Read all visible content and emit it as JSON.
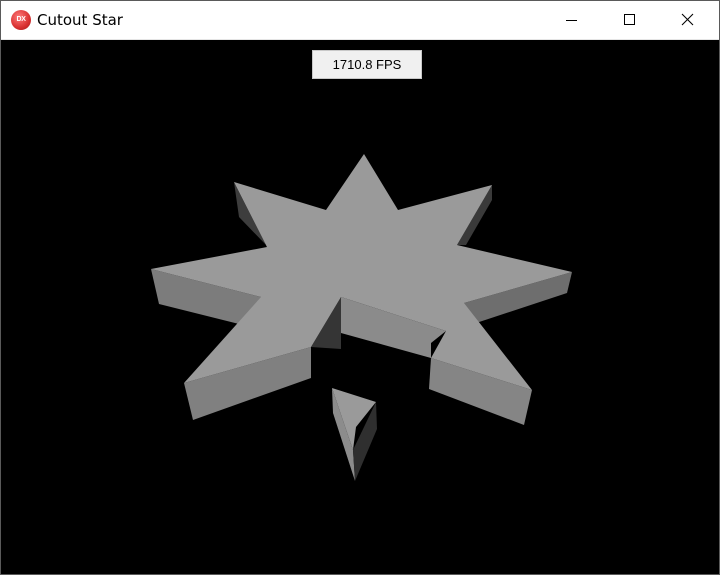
{
  "window": {
    "title": "Cutout Star",
    "icon_name": "directx-app-icon",
    "icon_text": "DX"
  },
  "caption_buttons": {
    "minimize_icon": "minimize-icon",
    "maximize_icon": "maximize-icon",
    "close_icon": "close-icon"
  },
  "overlay": {
    "fps_text": "1710.8 FPS"
  },
  "scene": {
    "background_color": "#000000",
    "top_face_color": "#9a9a9a",
    "light_side_color": "#8a8a8a",
    "dark_side_color": "#3c3c3c"
  }
}
